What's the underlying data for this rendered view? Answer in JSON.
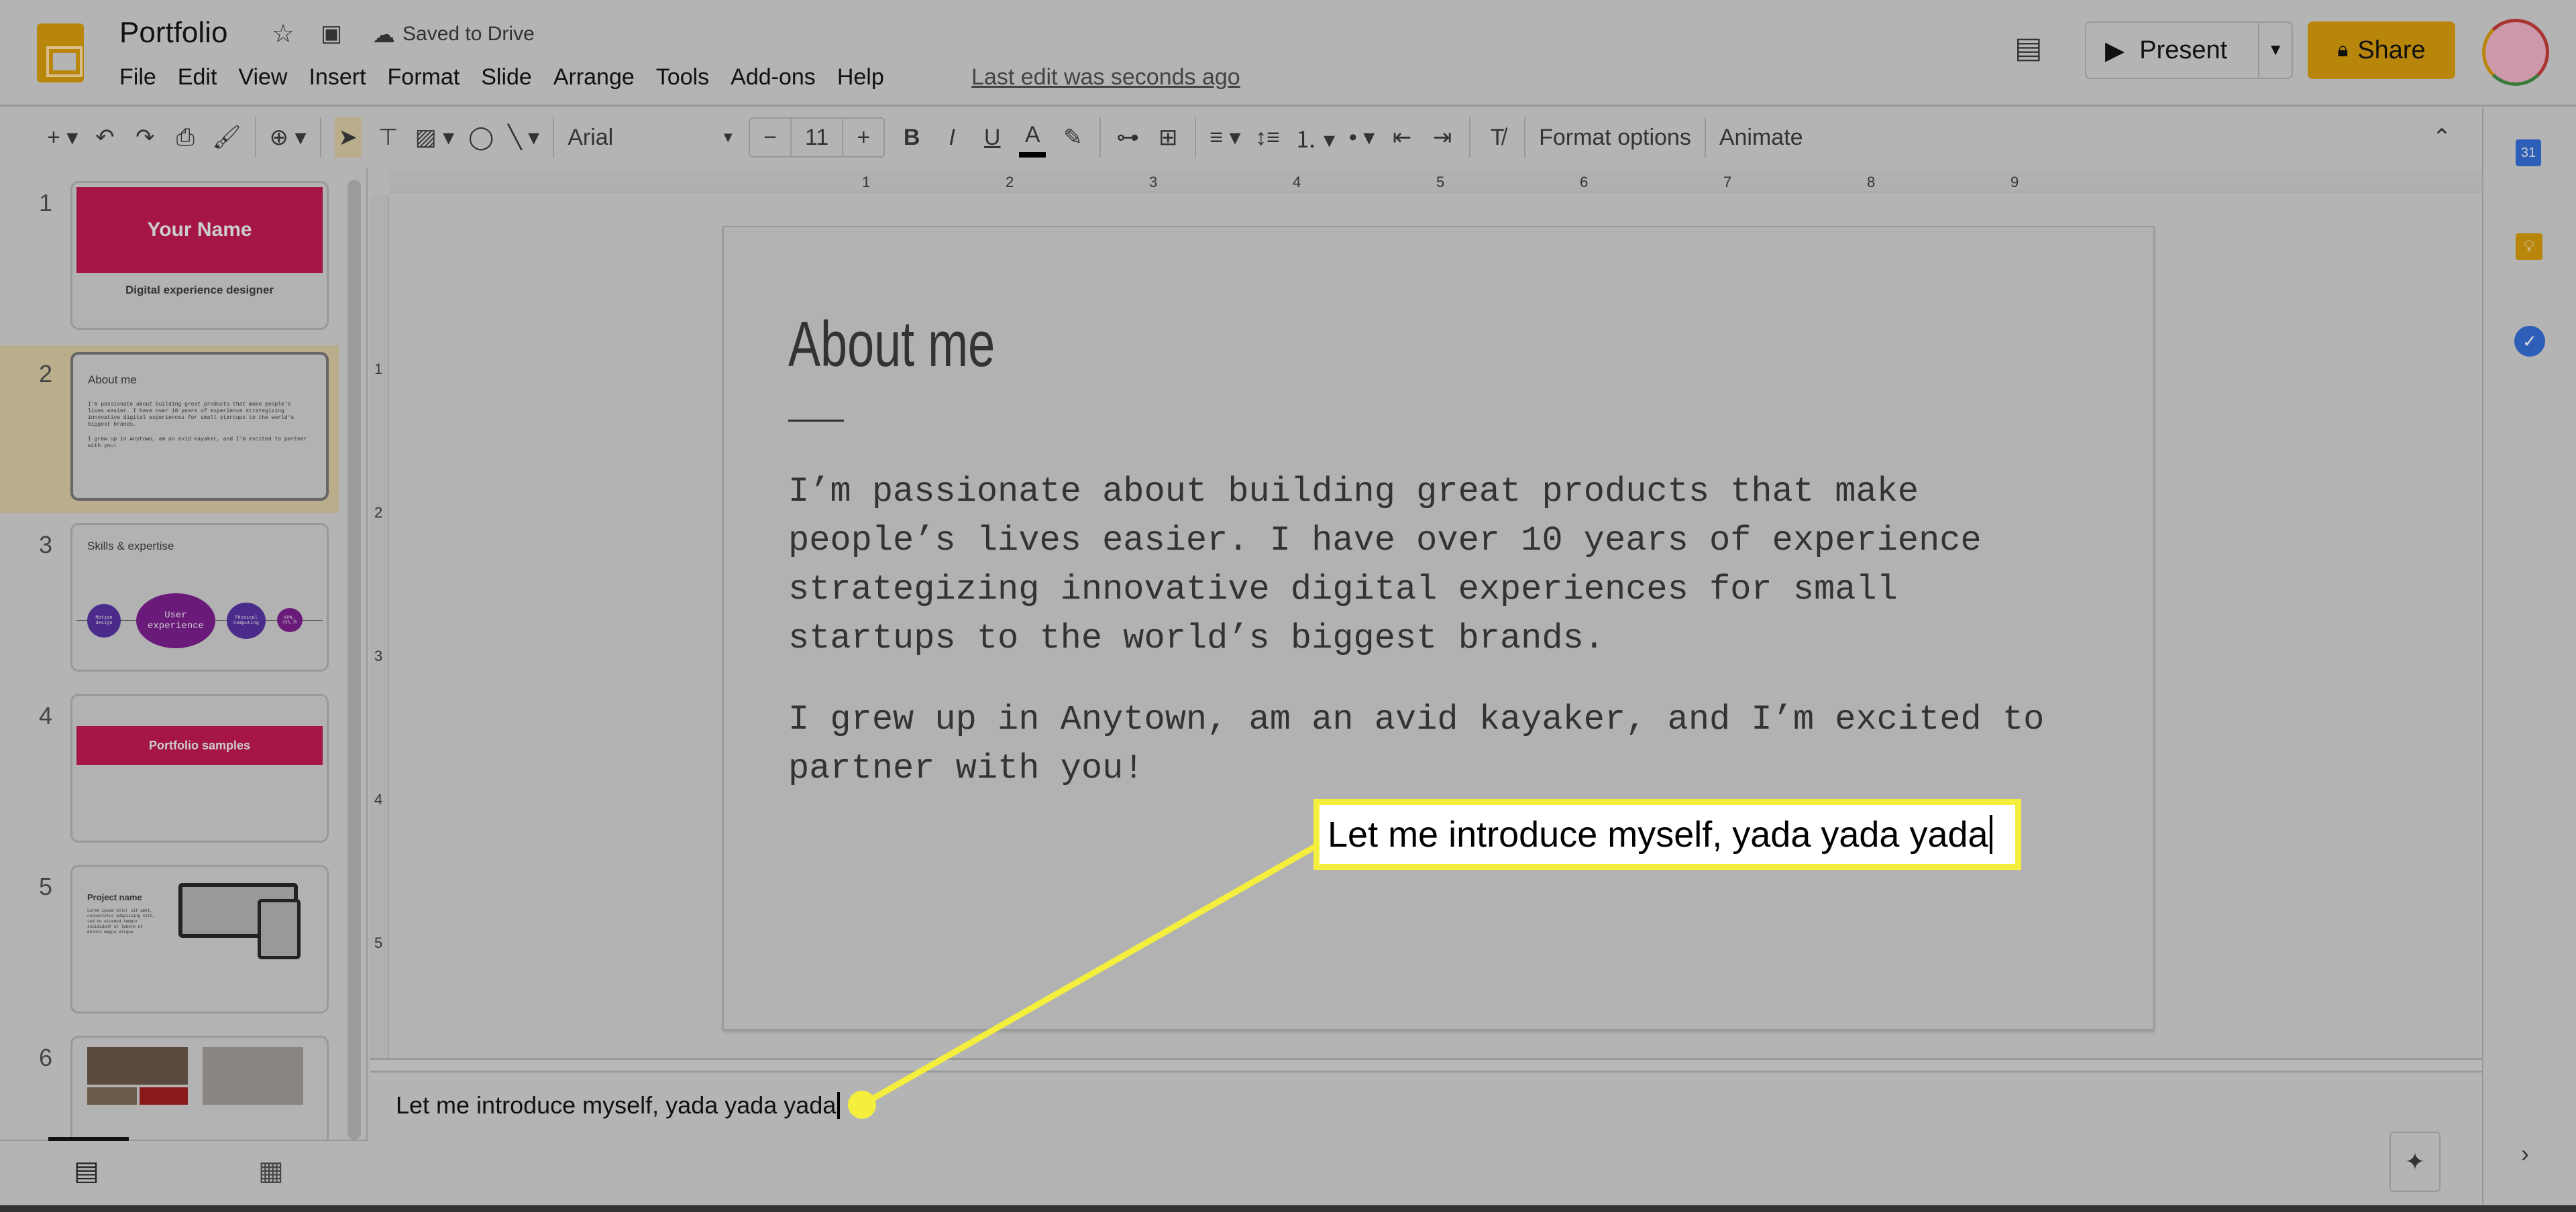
{
  "app": {
    "title": "Portfolio",
    "save_status": "Saved to Drive",
    "last_edit": "Last edit was seconds ago",
    "menu": [
      "File",
      "Edit",
      "View",
      "Insert",
      "Format",
      "Slide",
      "Arrange",
      "Tools",
      "Add-ons",
      "Help"
    ],
    "present_label": "Present",
    "share_label": "Share"
  },
  "toolbar": {
    "font": "Arial",
    "font_size": "11",
    "format_options": "Format options",
    "animate": "Animate",
    "minus": "−",
    "plus": "+"
  },
  "ruler": {
    "h": [
      "1",
      "2",
      "3",
      "4",
      "5",
      "6",
      "7",
      "8",
      "9"
    ],
    "v": [
      "1",
      "2",
      "3",
      "4",
      "5"
    ]
  },
  "thumbnails": [
    {
      "num": "1",
      "title": "Your Name",
      "subtitle": "Digital experience designer"
    },
    {
      "num": "2",
      "title": "About me",
      "body": "I'm passionate about building great products that make people's lives easier. I have over 10 years of experience strategizing innovative digital experiences for small startups to the world's biggest brands.",
      "body2": "I grew up in Anytown, am an avid kayaker, and I'm excited to partner with you!"
    },
    {
      "num": "3",
      "title": "Skills & expertise",
      "bubbles": [
        "Motion design",
        "User experience",
        "Physical Computing",
        "HTML, CSS,JS"
      ]
    },
    {
      "num": "4",
      "title": "Portfolio samples"
    },
    {
      "num": "5",
      "title": "Project name",
      "body": "Lorem ipsum dolor sit amet, consectetur adipiscing elit, sed do eiusmod tempor incididunt ut labore et dolore magna aliqua"
    },
    {
      "num": "6"
    }
  ],
  "slide": {
    "title": "About me",
    "dash": "———",
    "para1": "I’m passionate about building great products that make\npeople’s lives easier. I have over 10 years of experience\nstrategizing innovative digital experiences for small\nstartups to the world’s biggest brands.",
    "para2": "I grew up in Anytown, am an avid kayaker, and I’m excited to\npartner with you!"
  },
  "callout": {
    "text": "Let me introduce myself, yada yada yada",
    "color": "#f4ee3c"
  },
  "notes": {
    "text": "Let me introduce myself, yada yada yada"
  },
  "colors": {
    "accent": "#b8860b",
    "slide_band": "#a51646",
    "bubble": "#6a1b7a"
  }
}
